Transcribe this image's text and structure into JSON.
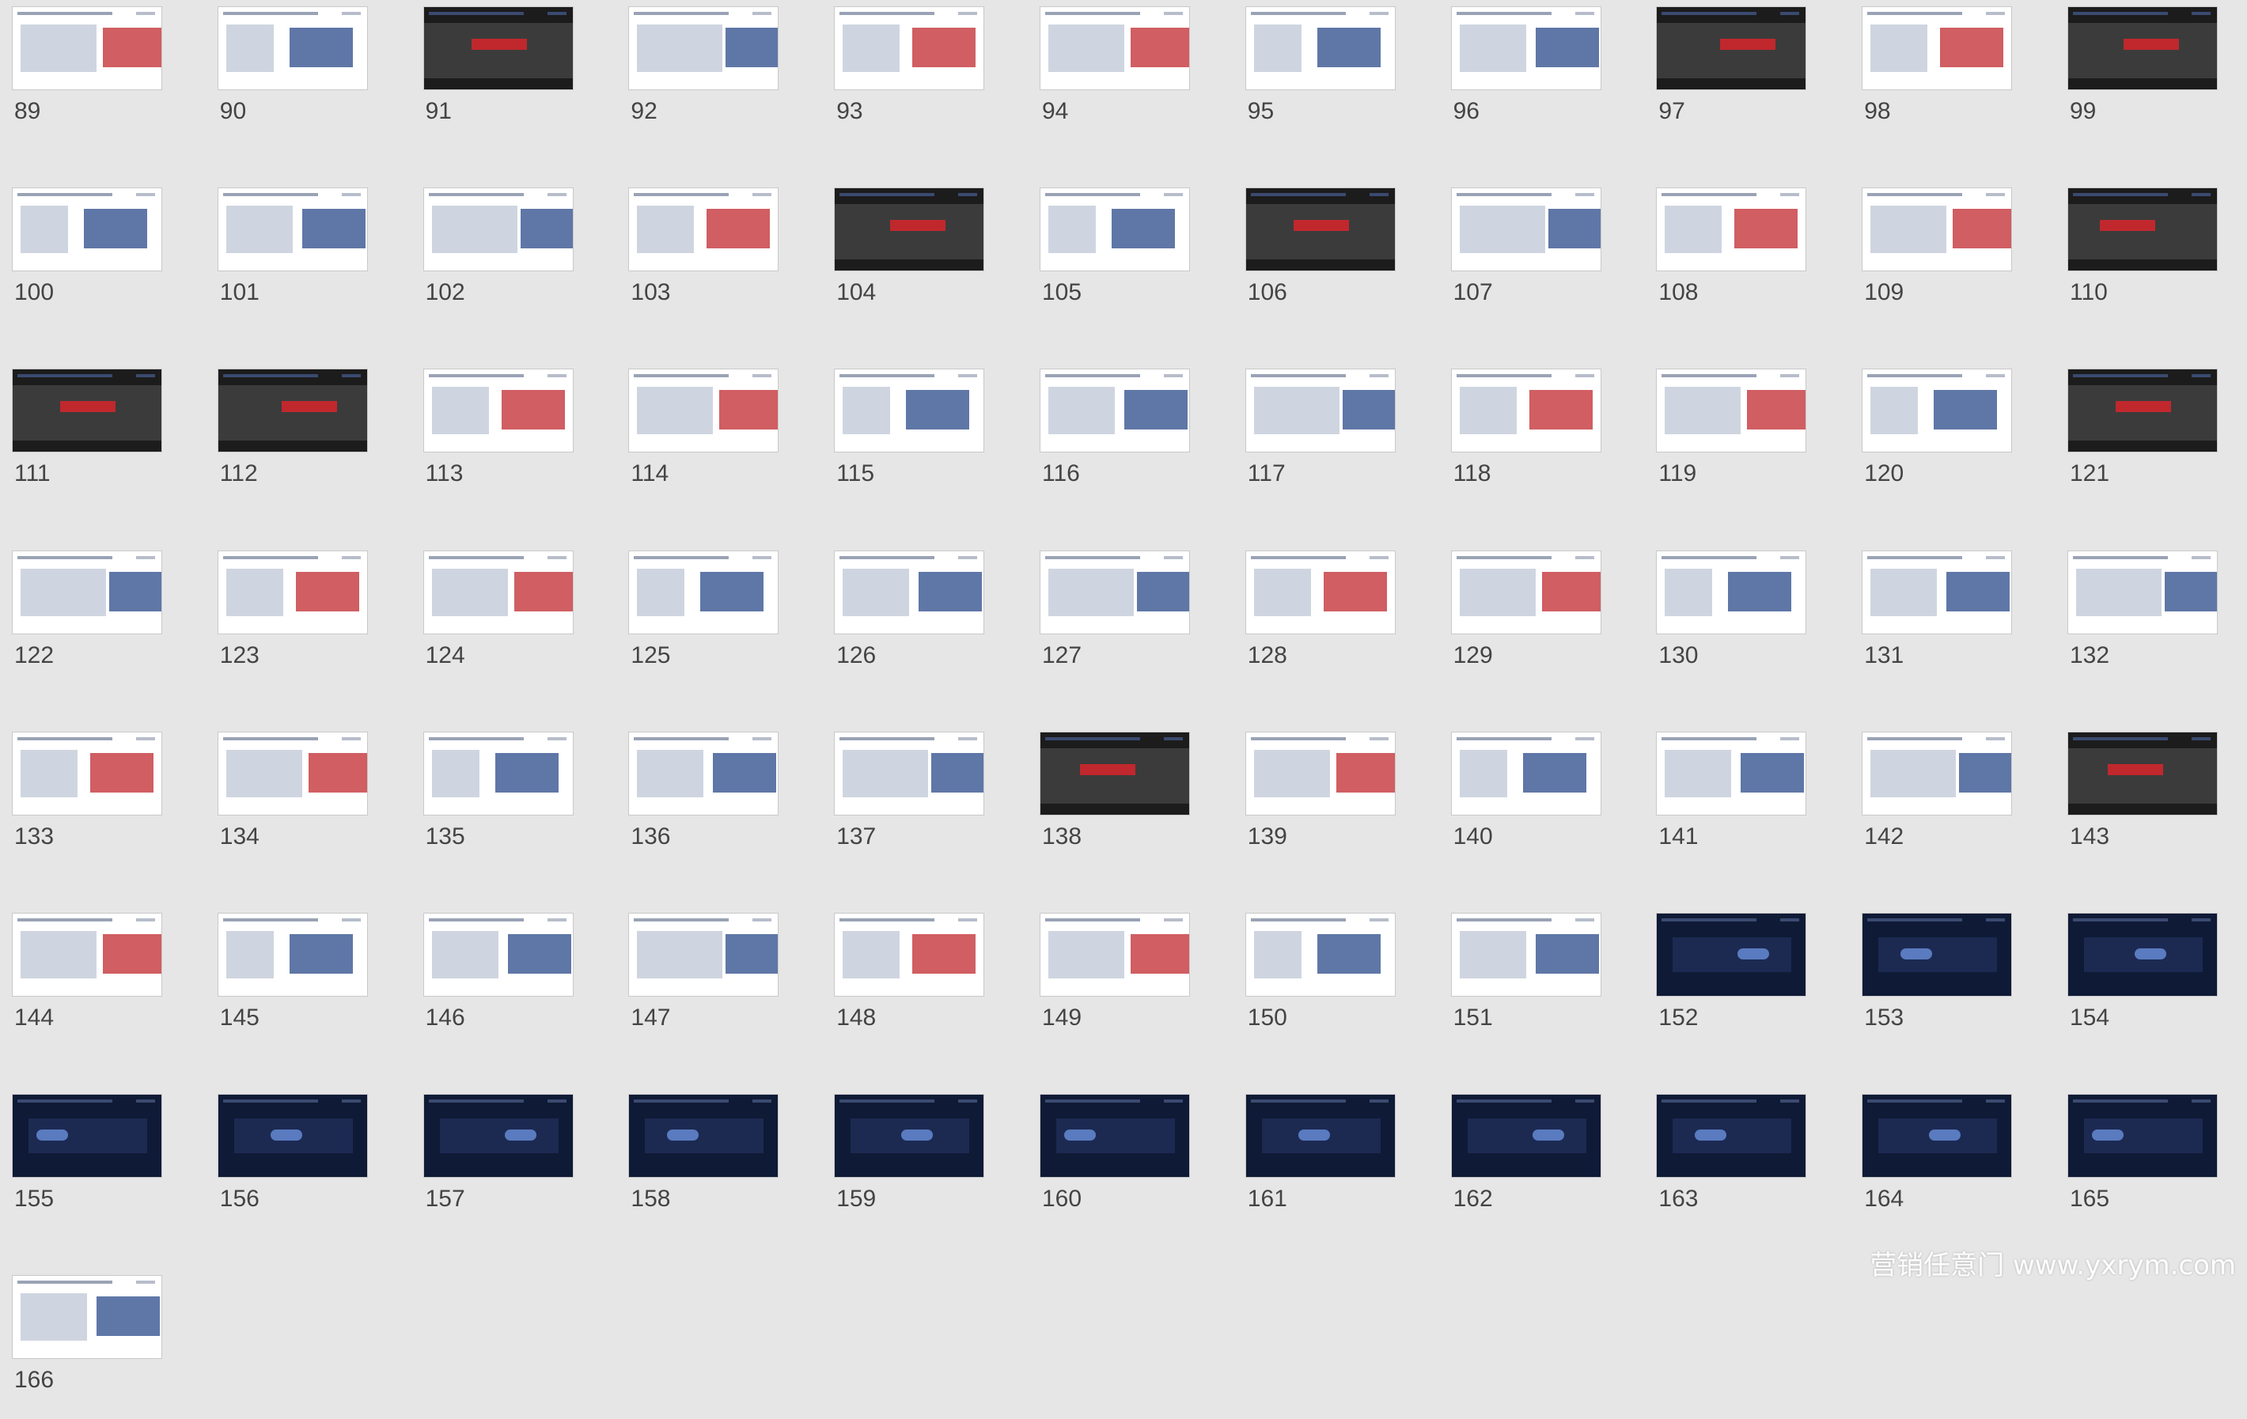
{
  "slides": [
    {
      "n": "89",
      "theme": "light"
    },
    {
      "n": "90",
      "theme": "light"
    },
    {
      "n": "91",
      "theme": "dark"
    },
    {
      "n": "92",
      "theme": "light"
    },
    {
      "n": "93",
      "theme": "light"
    },
    {
      "n": "94",
      "theme": "light"
    },
    {
      "n": "95",
      "theme": "light"
    },
    {
      "n": "96",
      "theme": "light"
    },
    {
      "n": "97",
      "theme": "dark"
    },
    {
      "n": "98",
      "theme": "light"
    },
    {
      "n": "99",
      "theme": "dark"
    },
    {
      "n": "100",
      "theme": "light"
    },
    {
      "n": "101",
      "theme": "light"
    },
    {
      "n": "102",
      "theme": "light"
    },
    {
      "n": "103",
      "theme": "light"
    },
    {
      "n": "104",
      "theme": "dark"
    },
    {
      "n": "105",
      "theme": "light"
    },
    {
      "n": "106",
      "theme": "dark"
    },
    {
      "n": "107",
      "theme": "light"
    },
    {
      "n": "108",
      "theme": "light"
    },
    {
      "n": "109",
      "theme": "light"
    },
    {
      "n": "110",
      "theme": "dark"
    },
    {
      "n": "111",
      "theme": "dark"
    },
    {
      "n": "112",
      "theme": "dark"
    },
    {
      "n": "113",
      "theme": "light"
    },
    {
      "n": "114",
      "theme": "light"
    },
    {
      "n": "115",
      "theme": "light"
    },
    {
      "n": "116",
      "theme": "light"
    },
    {
      "n": "117",
      "theme": "light"
    },
    {
      "n": "118",
      "theme": "light"
    },
    {
      "n": "119",
      "theme": "light"
    },
    {
      "n": "120",
      "theme": "light"
    },
    {
      "n": "121",
      "theme": "dark"
    },
    {
      "n": "122",
      "theme": "light"
    },
    {
      "n": "123",
      "theme": "light"
    },
    {
      "n": "124",
      "theme": "light"
    },
    {
      "n": "125",
      "theme": "light"
    },
    {
      "n": "126",
      "theme": "light"
    },
    {
      "n": "127",
      "theme": "light"
    },
    {
      "n": "128",
      "theme": "light"
    },
    {
      "n": "129",
      "theme": "light"
    },
    {
      "n": "130",
      "theme": "light"
    },
    {
      "n": "131",
      "theme": "light"
    },
    {
      "n": "132",
      "theme": "light"
    },
    {
      "n": "133",
      "theme": "light"
    },
    {
      "n": "134",
      "theme": "light"
    },
    {
      "n": "135",
      "theme": "light"
    },
    {
      "n": "136",
      "theme": "light"
    },
    {
      "n": "137",
      "theme": "light"
    },
    {
      "n": "138",
      "theme": "dark"
    },
    {
      "n": "139",
      "theme": "light"
    },
    {
      "n": "140",
      "theme": "light"
    },
    {
      "n": "141",
      "theme": "light"
    },
    {
      "n": "142",
      "theme": "light"
    },
    {
      "n": "143",
      "theme": "dark"
    },
    {
      "n": "144",
      "theme": "light"
    },
    {
      "n": "145",
      "theme": "light"
    },
    {
      "n": "146",
      "theme": "light"
    },
    {
      "n": "147",
      "theme": "light"
    },
    {
      "n": "148",
      "theme": "light"
    },
    {
      "n": "149",
      "theme": "light"
    },
    {
      "n": "150",
      "theme": "light"
    },
    {
      "n": "151",
      "theme": "light"
    },
    {
      "n": "152",
      "theme": "navy"
    },
    {
      "n": "153",
      "theme": "navy"
    },
    {
      "n": "154",
      "theme": "navy"
    },
    {
      "n": "155",
      "theme": "navy"
    },
    {
      "n": "156",
      "theme": "navy"
    },
    {
      "n": "157",
      "theme": "navy"
    },
    {
      "n": "158",
      "theme": "navy"
    },
    {
      "n": "159",
      "theme": "navy"
    },
    {
      "n": "160",
      "theme": "navy"
    },
    {
      "n": "161",
      "theme": "navy"
    },
    {
      "n": "162",
      "theme": "navy"
    },
    {
      "n": "163",
      "theme": "navy"
    },
    {
      "n": "164",
      "theme": "navy"
    },
    {
      "n": "165",
      "theme": "navy"
    },
    {
      "n": "166",
      "theme": "light"
    }
  ],
  "watermark": "营销任意门 www.yxrym.com",
  "colors": {
    "background": "#e6e6e6",
    "light": "#ffffff",
    "dark": "#1c1c1c",
    "navy": "#0f1a36",
    "accent_red": "#c0282d",
    "accent_blue": "#2a4a8a"
  }
}
